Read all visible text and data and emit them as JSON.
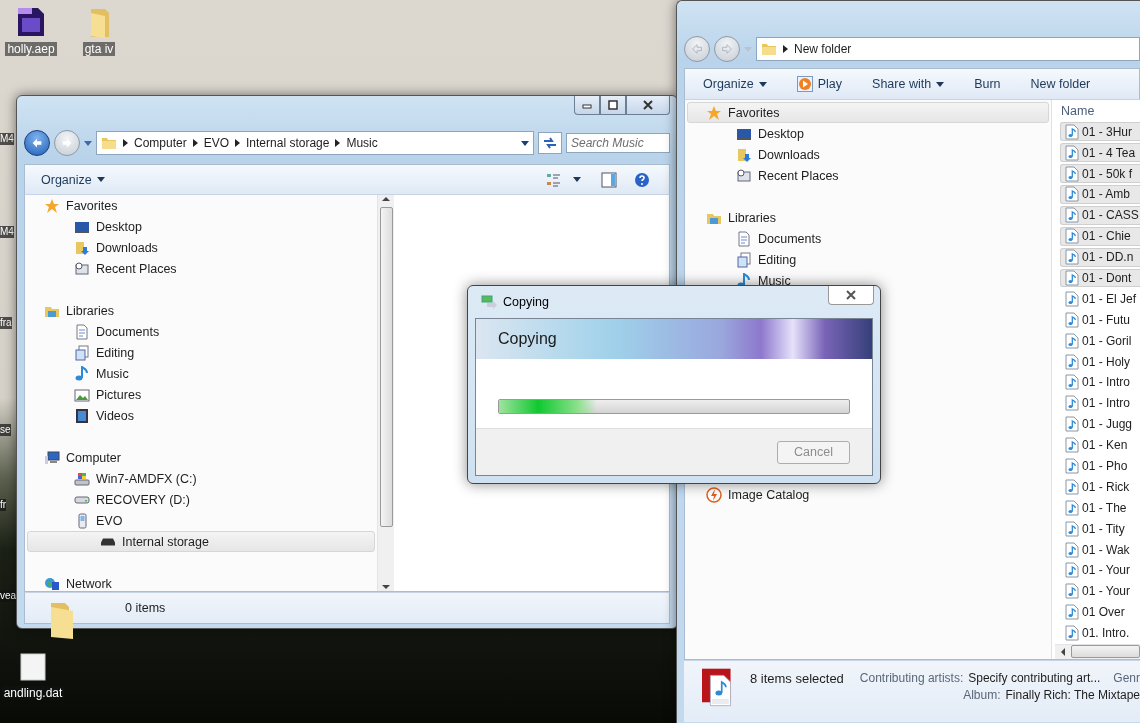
{
  "desktop": {
    "icons": [
      {
        "label": "holly.aep",
        "kind": "ae"
      },
      {
        "label": "gta iv",
        "kind": "folder"
      },
      {
        "label": "andling.dat",
        "kind": "file"
      }
    ],
    "edge_labels": [
      "M4",
      "M4",
      "fra",
      "se",
      "fr",
      "vea"
    ]
  },
  "music_window": {
    "address": {
      "crumbs": [
        "Computer",
        "EVO",
        "Internal storage",
        "Music"
      ]
    },
    "search": {
      "placeholder": "Search Music"
    },
    "toolbar": {
      "organize": "Organize"
    },
    "nav": [
      {
        "label": "Favorites",
        "kind": "favorites",
        "selected": false,
        "children": [
          {
            "label": "Desktop",
            "kind": "desktop",
            "selected": false
          },
          {
            "label": "Downloads",
            "kind": "downloads",
            "selected": false
          },
          {
            "label": "Recent Places",
            "kind": "recent",
            "selected": false
          }
        ]
      },
      {
        "label": "Libraries",
        "kind": "libraries",
        "selected": false,
        "children": [
          {
            "label": "Documents",
            "kind": "documents",
            "selected": false
          },
          {
            "label": "Editing",
            "kind": "editing",
            "selected": false
          },
          {
            "label": "Music",
            "kind": "music",
            "selected": false
          },
          {
            "label": "Pictures",
            "kind": "pictures",
            "selected": false
          },
          {
            "label": "Videos",
            "kind": "videos",
            "selected": false
          }
        ]
      },
      {
        "label": "Computer",
        "kind": "computer",
        "selected": false,
        "children": [
          {
            "label": "Win7-AMDFX (C:)",
            "kind": "windrive",
            "selected": false
          },
          {
            "label": "RECOVERY (D:)",
            "kind": "drive",
            "selected": false
          },
          {
            "label": "EVO",
            "kind": "phone",
            "selected": false,
            "children": [
              {
                "label": "Internal storage",
                "kind": "storage",
                "selected": true
              }
            ]
          }
        ]
      },
      {
        "label": "Network",
        "kind": "network",
        "selected": false
      }
    ],
    "status": "0 items"
  },
  "folder_window": {
    "address": {
      "crumbs": [
        "New folder"
      ]
    },
    "toolbar": [
      {
        "label": "Organize",
        "kind": "menu"
      },
      {
        "label": "Play",
        "kind": "play"
      },
      {
        "label": "Share with",
        "kind": "menu"
      },
      {
        "label": "Burn",
        "kind": "plain"
      },
      {
        "label": "New folder",
        "kind": "plain"
      }
    ],
    "nav": [
      {
        "label": "Favorites",
        "kind": "favorites",
        "selected": true,
        "children": [
          {
            "label": "Desktop",
            "kind": "desktop",
            "selected": false
          },
          {
            "label": "Downloads",
            "kind": "downloads",
            "selected": false
          },
          {
            "label": "Recent Places",
            "kind": "recent",
            "selected": false
          }
        ]
      },
      {
        "label": "Libraries",
        "kind": "libraries",
        "selected": false,
        "children": [
          {
            "label": "Documents",
            "kind": "documents",
            "selected": false
          },
          {
            "label": "Editing",
            "kind": "editing",
            "selected": false
          },
          {
            "label": "Music",
            "kind": "music",
            "selected": false
          }
        ]
      },
      {
        "label": "Image Catalog",
        "kind": "catalog",
        "selected": false
      }
    ],
    "files": {
      "column": "Name",
      "rows": [
        {
          "name": "01 - 3Hur",
          "selected": true
        },
        {
          "name": "01 - 4 Tea",
          "selected": true
        },
        {
          "name": "01 - 50k f",
          "selected": true
        },
        {
          "name": "01 - Amb",
          "selected": true
        },
        {
          "name": "01 - CASS",
          "selected": true
        },
        {
          "name": "01 - Chie",
          "selected": true
        },
        {
          "name": "01 - DD.n",
          "selected": true
        },
        {
          "name": "01 - Dont",
          "selected": true
        },
        {
          "name": "01 - El Jef",
          "selected": false
        },
        {
          "name": "01 - Futu",
          "selected": false
        },
        {
          "name": "01 - Goril",
          "selected": false
        },
        {
          "name": "01 - Holy",
          "selected": false
        },
        {
          "name": "01 - Intro",
          "selected": false
        },
        {
          "name": "01 - Intro",
          "selected": false
        },
        {
          "name": "01 - Jugg",
          "selected": false
        },
        {
          "name": "01 - Ken",
          "selected": false
        },
        {
          "name": "01 - Pho",
          "selected": false
        },
        {
          "name": "01 - Rick",
          "selected": false
        },
        {
          "name": "01 - The",
          "selected": false
        },
        {
          "name": "01 - Tity",
          "selected": false
        },
        {
          "name": "01 - Wak",
          "selected": false
        },
        {
          "name": "01 - Your",
          "selected": false
        },
        {
          "name": "01 - Your",
          "selected": false
        },
        {
          "name": "01 Over",
          "selected": false
        },
        {
          "name": "01. Intro.",
          "selected": false
        }
      ]
    },
    "details": {
      "count": "8 items selected",
      "fields": [
        {
          "label": "Contributing artists:",
          "value": "Specify contributing art..."
        },
        {
          "label": "Album:",
          "value": "Finally Rich: The Mixtape"
        }
      ],
      "next_label": "Genr"
    }
  },
  "copy_dialog": {
    "title": "Copying",
    "heading": "Copying",
    "progress": {
      "level": 0.28
    },
    "buttons": [
      {
        "label": "Cancel",
        "disabled": true
      }
    ]
  }
}
